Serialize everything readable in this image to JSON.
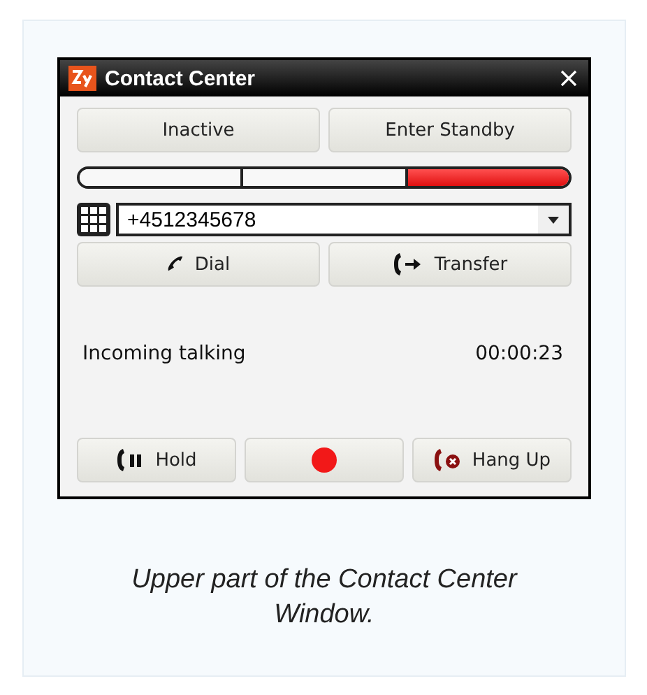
{
  "window": {
    "title": "Contact Center"
  },
  "status_buttons": [
    "Inactive",
    "Enter Standby"
  ],
  "state_bar": {
    "segments": [
      {
        "lit": false
      },
      {
        "lit": false
      },
      {
        "lit": true
      }
    ]
  },
  "number_field": {
    "value": "+4512345678"
  },
  "call_buttons": [
    {
      "kind": "dial",
      "label": "Dial"
    },
    {
      "kind": "transfer",
      "label": "Transfer"
    }
  ],
  "status": {
    "text": "Incoming talking",
    "timer": "00:00:23"
  },
  "bottom_buttons": [
    {
      "kind": "hold",
      "label": "Hold"
    },
    {
      "kind": "record"
    },
    {
      "kind": "hangup",
      "label": "Hang Up"
    }
  ],
  "caption": "Upper part of the Contact Center Window."
}
